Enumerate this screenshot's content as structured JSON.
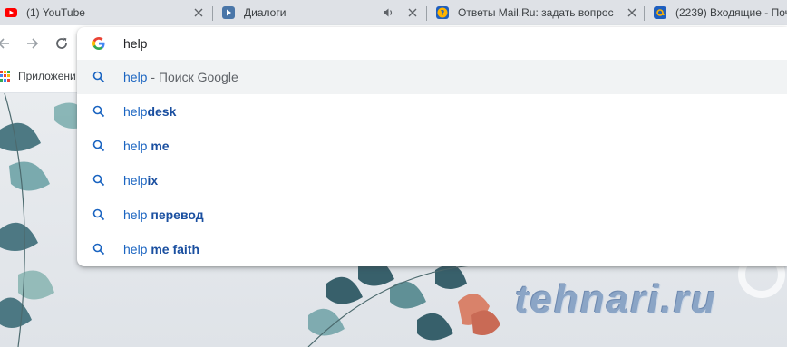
{
  "tabs": [
    {
      "title": "(1) YouTube",
      "favicon": "youtube-icon"
    },
    {
      "title": "Диалоги",
      "favicon": "vk-icon",
      "audio": "speaker-icon"
    },
    {
      "title": "Ответы Mail.Ru: задать вопрос",
      "favicon": "question-icon"
    },
    {
      "title": "(2239) Входящие - Поч",
      "favicon": "mail-at-icon"
    }
  ],
  "toolbar": {
    "back": "back-arrow-icon",
    "forward": "forward-arrow-icon",
    "reload": "reload-icon"
  },
  "bookmarks": {
    "apps_label": "Приложени"
  },
  "omnibox": {
    "value": "help",
    "suggestions": [
      {
        "plain": "help",
        "bold": "",
        "desc": " - Поиск Google"
      },
      {
        "plain": "help",
        "bold": "desk",
        "desc": ""
      },
      {
        "plain": "help ",
        "bold": "me",
        "desc": ""
      },
      {
        "plain": "help",
        "bold": "ix",
        "desc": ""
      },
      {
        "plain": "help ",
        "bold": "перевод",
        "desc": ""
      },
      {
        "plain": "help ",
        "bold": "me faith",
        "desc": ""
      }
    ]
  },
  "watermark": "tehnari.ru",
  "colors": {
    "tabstrip": "#dee1e6",
    "link_blue": "#1a64c1",
    "selected_row": "#f1f3f4"
  }
}
